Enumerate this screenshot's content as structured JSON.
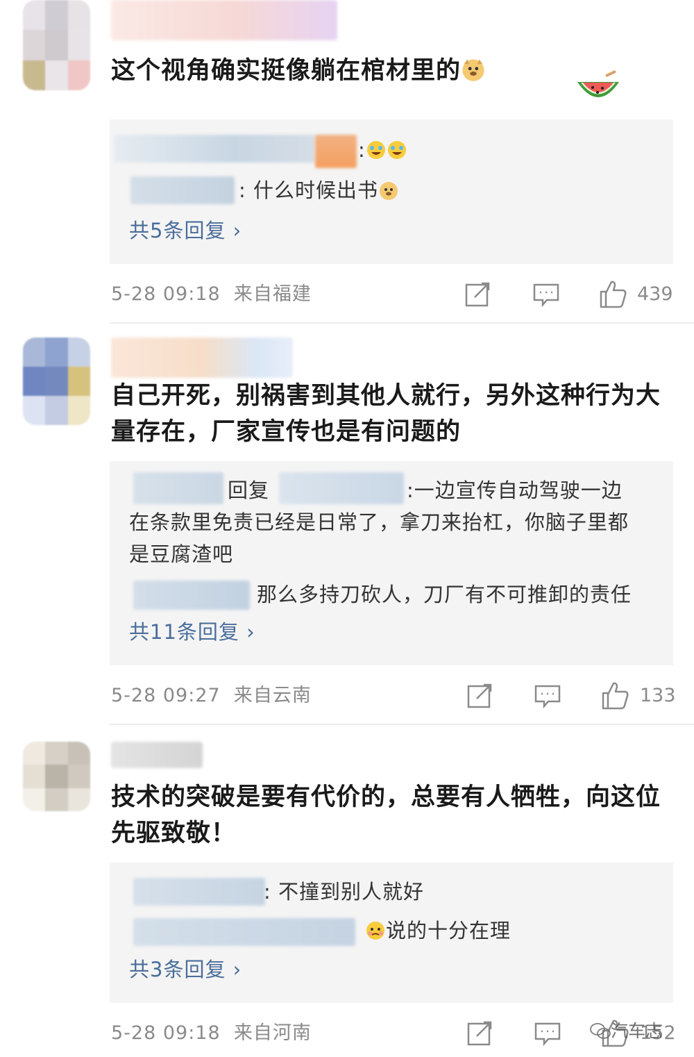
{
  "comments": [
    {
      "text": "这个视角确实挺像躺在棺材里的",
      "replies": [
        {
          "text": ":"
        },
        {
          "text": ": 什么时候出书"
        }
      ],
      "more": "共5条回复 ›",
      "time": "5-28 09:18",
      "location": "来自福建",
      "likes": "439"
    },
    {
      "text_line1": "自己开死，别祸害到其他人就行，另外这种行为大",
      "text_line2": "量存在，厂家宣传也是有问题的",
      "reply1_mid": "回复",
      "reply1_a": ":一边宣传自动驾驶一边",
      "reply1_b": "在条款里免责已经是日常了，拿刀来抬杠，你脑子里都",
      "reply1_c": "是豆腐渣吧",
      "reply2": "那么多持刀砍人，刀厂有不可推卸的责任",
      "more": "共11条回复 ›",
      "time": "5-28 09:27",
      "location": "来自云南",
      "likes": "133"
    },
    {
      "text_line1": "技术的突破是要有代价的，总要有人牺牲，向这位",
      "text_line2": "先驱致敬！",
      "reply1": ": 不撞到别人就好",
      "reply2": "说的十分在理",
      "more": "共3条回复 ›",
      "time": "5-28 09:18",
      "location": "来自河南",
      "likes": "152"
    }
  ],
  "watermark": "汽车志",
  "colors": {
    "link": "#4a6d9a",
    "meta": "#8a8a8a",
    "reply_bg": "#f4f4f4"
  }
}
